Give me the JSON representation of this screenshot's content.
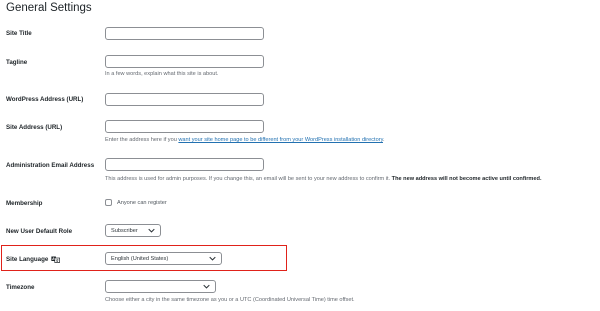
{
  "page": {
    "title": "General Settings"
  },
  "fields": {
    "site_title": {
      "label": "Site Title",
      "value": ""
    },
    "tagline": {
      "label": "Tagline",
      "value": "",
      "description": "In a few words, explain what this site is about."
    },
    "wp_address": {
      "label": "WordPress Address (URL)",
      "value": ""
    },
    "site_address": {
      "label": "Site Address (URL)",
      "value": "",
      "desc_before": "Enter the address here if you ",
      "desc_link": "want your site home page to be different from your WordPress installation directory",
      "desc_after": "."
    },
    "admin_email": {
      "label": "Administration Email Address",
      "value": "",
      "desc_normal": "This address is used for admin purposes. If you change this, an email will be sent to your new address to confirm it. ",
      "desc_bold": "The new address will not become active until confirmed."
    },
    "membership": {
      "label": "Membership",
      "checkbox_label": "Anyone can register",
      "checked": false
    },
    "default_role": {
      "label": "New User Default Role",
      "selected": "Subscriber"
    },
    "site_language": {
      "label": "Site Language",
      "icon": "translate-icon",
      "selected": "English (United States)"
    },
    "timezone": {
      "label": "Timezone",
      "selected": "",
      "description": "Choose either a city in the same timezone as you or a UTC (Coordinated Universal Time) time offset."
    }
  },
  "colors": {
    "highlight_border": "#e0221a",
    "link": "#2271b1",
    "text": "#1d2327",
    "muted": "#646970"
  }
}
